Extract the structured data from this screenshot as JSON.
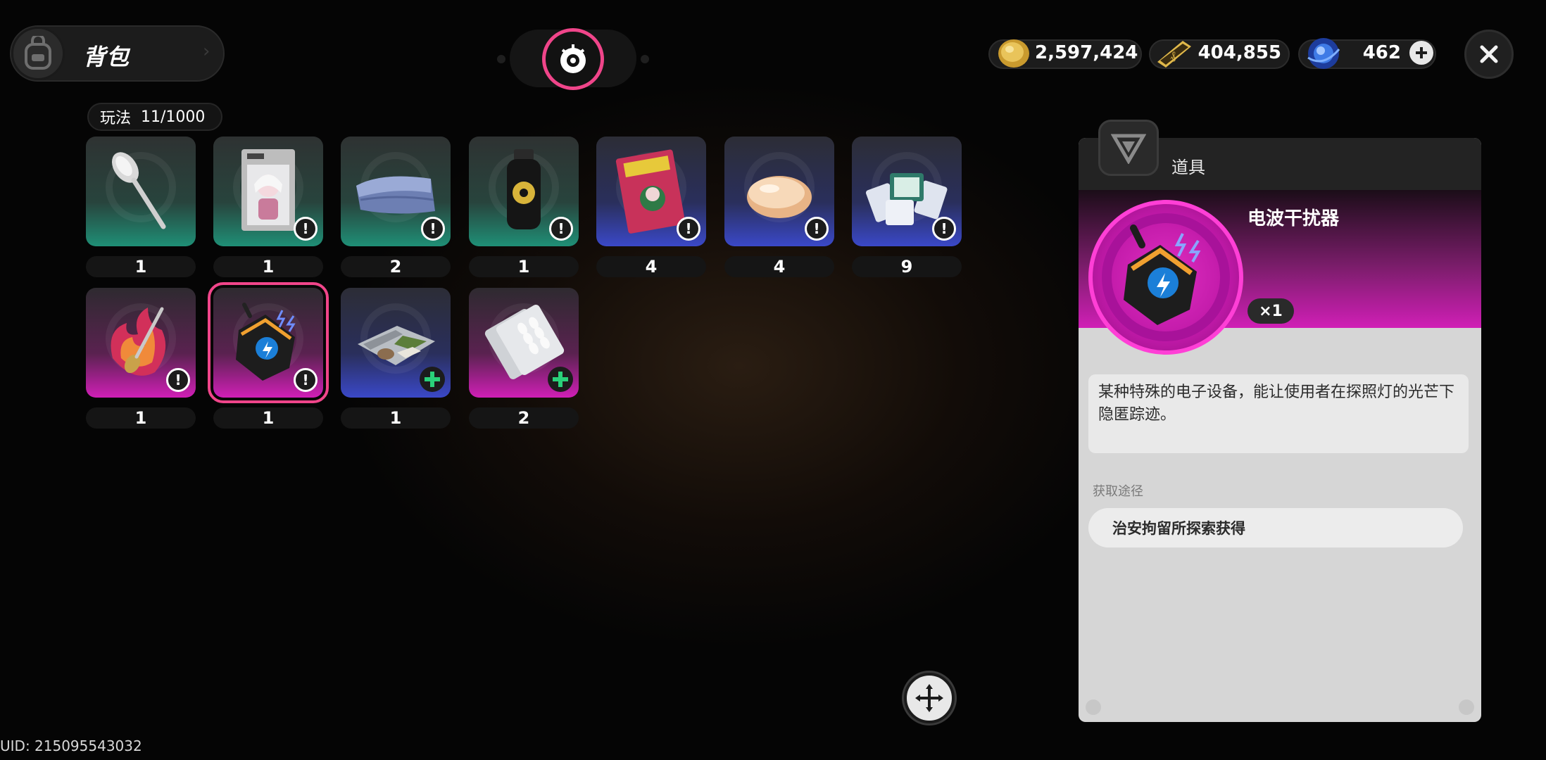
{
  "header": {
    "title": "背包"
  },
  "currencies": [
    {
      "name": "gold-coin-icon",
      "value": "2,597,424"
    },
    {
      "name": "ticket-icon",
      "value": "404,855"
    },
    {
      "name": "crystal-icon",
      "value": "462"
    }
  ],
  "capacity": {
    "label": "玩法",
    "value": "11/1000"
  },
  "items": [
    {
      "name": "spoon",
      "count": "1"
    },
    {
      "name": "figure-box",
      "count": "1"
    },
    {
      "name": "folded-blanket",
      "count": "2"
    },
    {
      "name": "biohazard-bottle",
      "count": "1"
    },
    {
      "name": "magazine",
      "count": "4"
    },
    {
      "name": "soap",
      "count": "4"
    },
    {
      "name": "playing-cards",
      "count": "9"
    },
    {
      "name": "flame-spoon",
      "count": "1"
    },
    {
      "name": "radio-jammer",
      "count": "1"
    },
    {
      "name": "food-tray",
      "count": "1"
    },
    {
      "name": "pill-blister",
      "count": "2"
    }
  ],
  "detail": {
    "category": "道具",
    "item_name": "电波干扰器",
    "quantity": "×1",
    "description": "某种特殊的电子设备，能让使用者在探照灯的光芒下隐匿踪迹。",
    "source_label": "获取途径",
    "source": "治安拘留所探索获得"
  },
  "uid": "UID: 215095543032",
  "colors": {
    "accent": "#f0458a",
    "magenta": "#d01fb6",
    "teal": "#1f8f76",
    "blue": "#3a48c8"
  }
}
